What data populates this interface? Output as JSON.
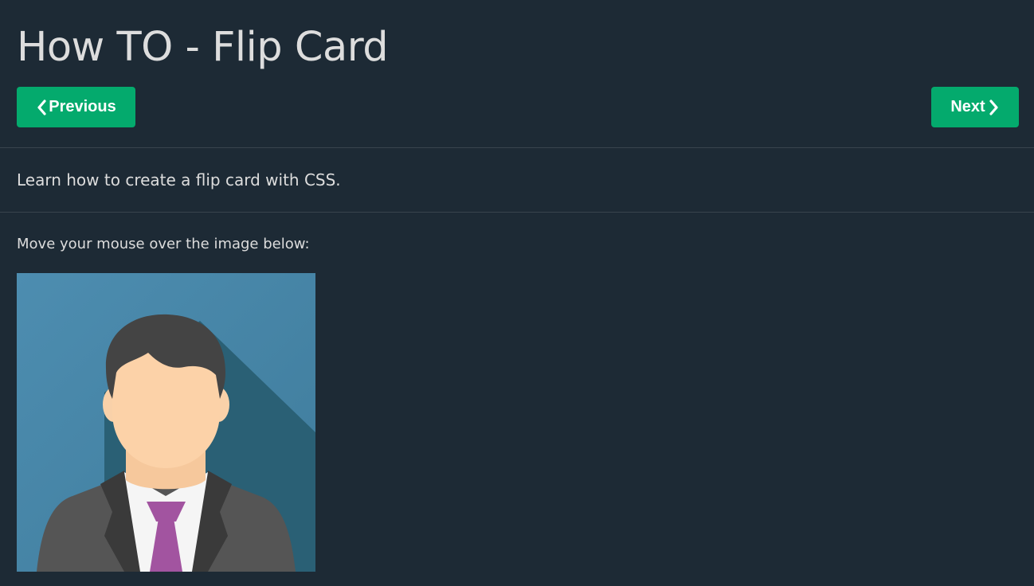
{
  "header": {
    "title": "How TO - Flip Card"
  },
  "nav": {
    "previous_label": "Previous",
    "next_label": "Next",
    "previous_icon": "chevron-left-icon",
    "next_icon": "chevron-right-icon"
  },
  "content": {
    "intro": "Learn how to create a flip card with CSS.",
    "instruction": "Move your mouse over the image below:"
  },
  "colors": {
    "background": "#1d2a35",
    "button": "#04aa6d",
    "card_background": "#4a8bab",
    "tie": "#a254a0"
  }
}
